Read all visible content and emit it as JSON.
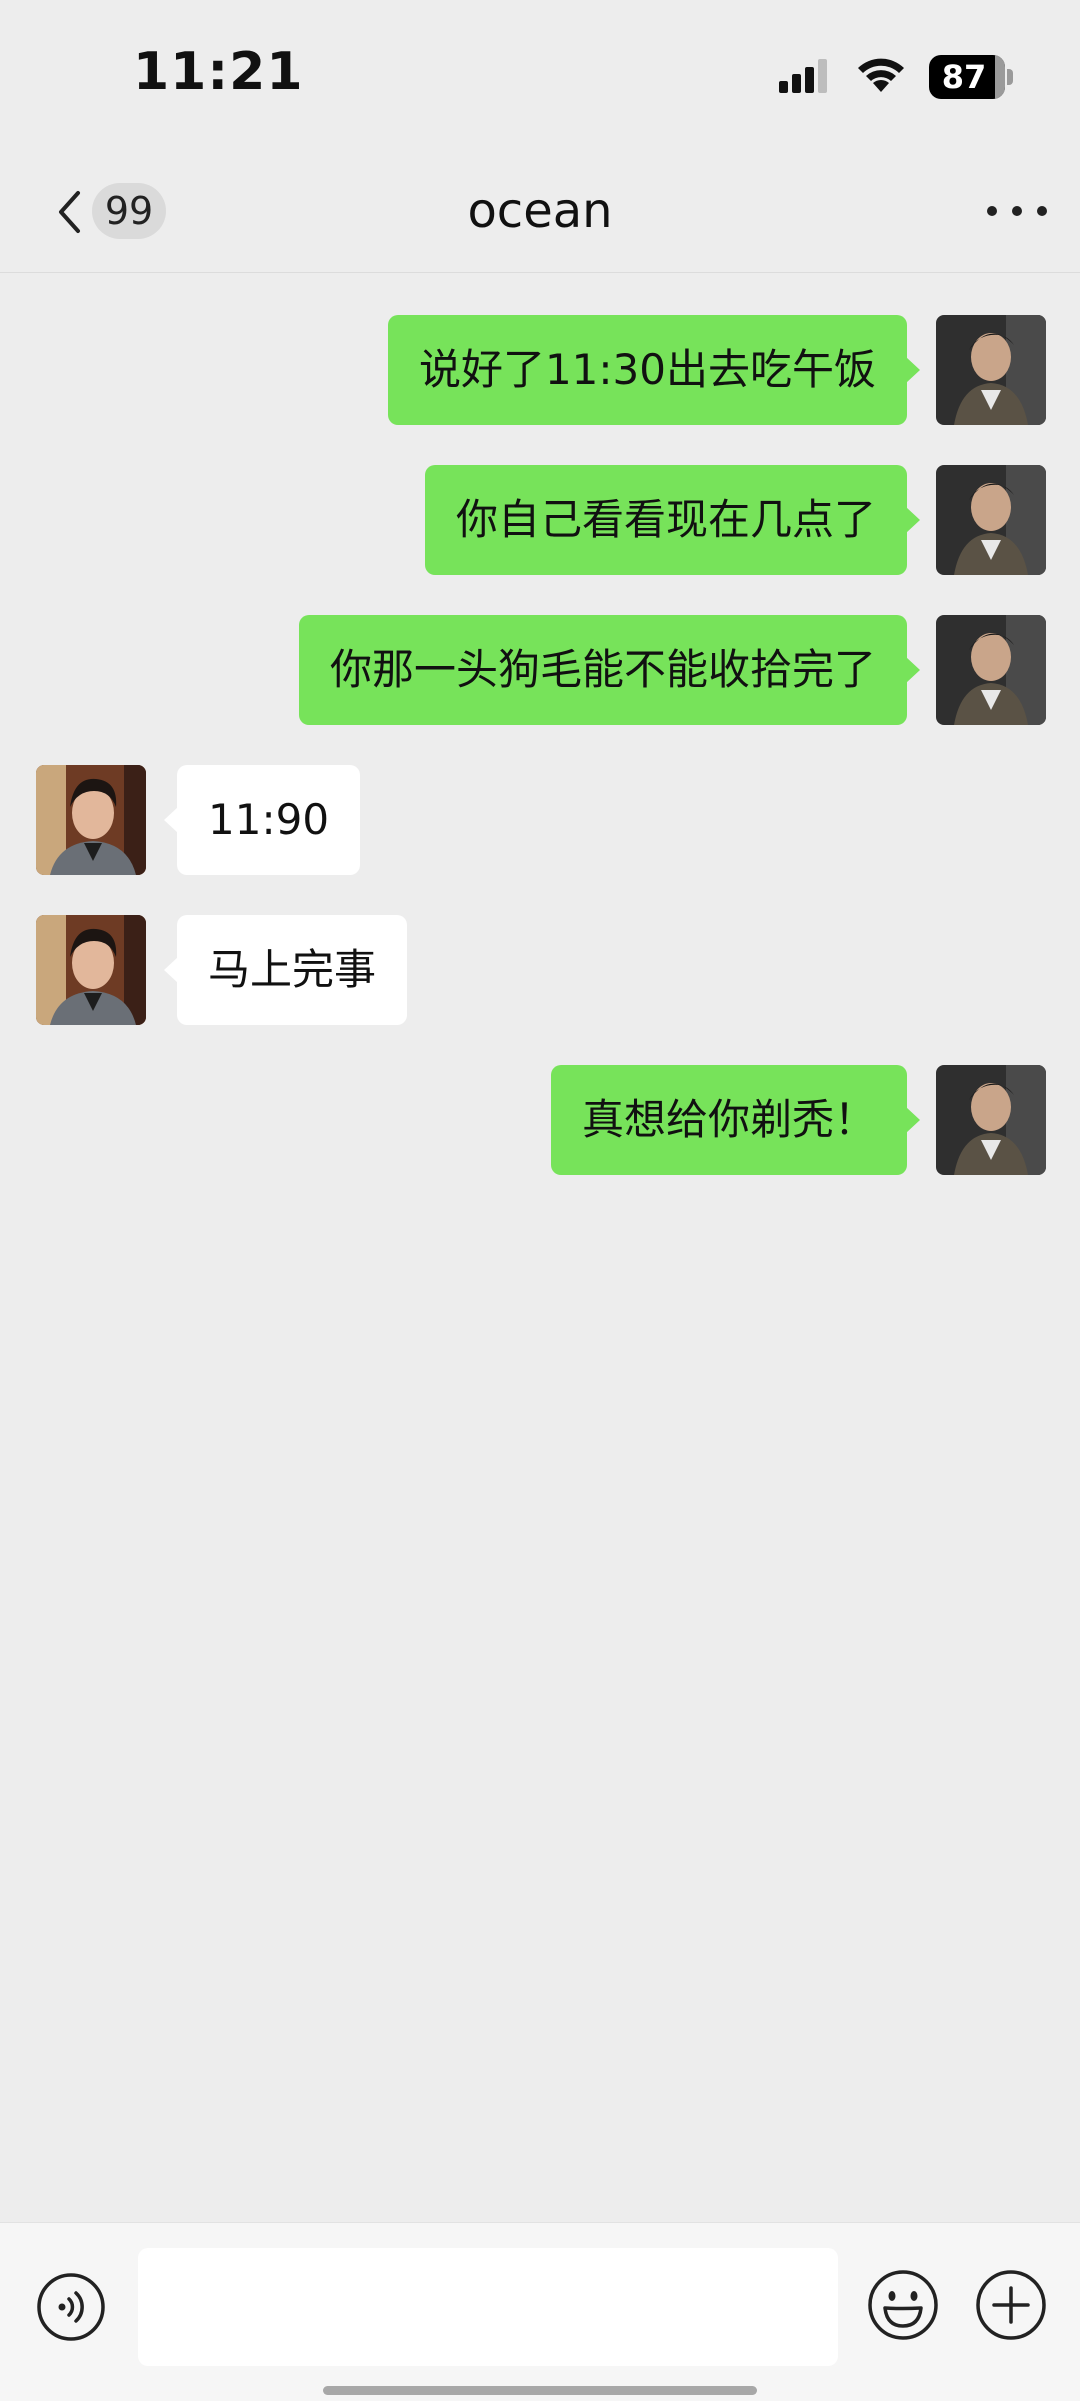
{
  "status_bar": {
    "time": "11:21",
    "battery_level": "87",
    "battery_fraction": 0.87
  },
  "header": {
    "back_badge": "99",
    "title": "ocean",
    "more_icon": "more-horizontal-icon"
  },
  "messages": [
    {
      "direction": "outgoing",
      "text": "说好了11:30出去吃午饭"
    },
    {
      "direction": "outgoing",
      "text": "你自己看看现在几点了"
    },
    {
      "direction": "outgoing",
      "text": "你那一头狗毛能不能收拾完了"
    },
    {
      "direction": "incoming",
      "text": "11:90"
    },
    {
      "direction": "incoming",
      "text": "马上完事"
    },
    {
      "direction": "outgoing",
      "text": "真想给你剃秃！"
    }
  ],
  "input_bar": {
    "placeholder": "",
    "voice_icon": "voice-icon",
    "emoji_icon": "emoji-icon",
    "plus_icon": "plus-icon"
  },
  "colors": {
    "background": "#ededed",
    "outgoing_bubble": "#77e35a",
    "incoming_bubble": "#ffffff"
  }
}
